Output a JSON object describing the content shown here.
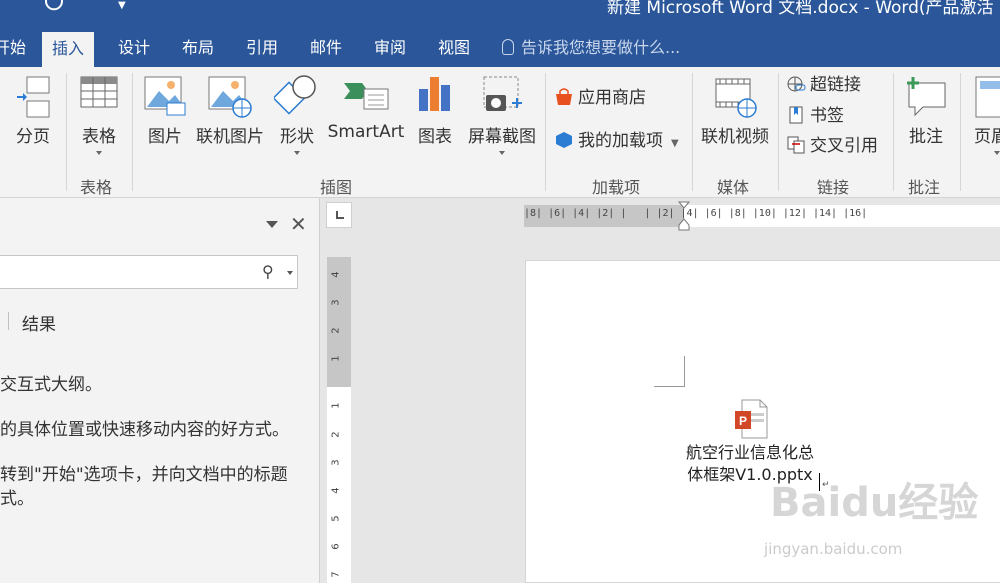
{
  "titlebar": {
    "title": "新建 Microsoft Word 文档.docx - Word(产品激活"
  },
  "tabs": [
    {
      "label": "开始"
    },
    {
      "label": "插入"
    },
    {
      "label": "设计"
    },
    {
      "label": "布局"
    },
    {
      "label": "引用"
    },
    {
      "label": "邮件"
    },
    {
      "label": "审阅"
    },
    {
      "label": "视图"
    }
  ],
  "tellme": {
    "label": "告诉我您想要做什么..."
  },
  "ribbon": {
    "page_break": "分页",
    "table": "表格",
    "picture": "图片",
    "online_picture": "联机图片",
    "shapes": "形状",
    "smartart": "SmartArt",
    "chart": "图表",
    "screenshot": "屏幕截图",
    "store": "应用商店",
    "my_addins": "我的加载项",
    "online_video": "联机视频",
    "hyperlink": "超链接",
    "bookmark": "书签",
    "cross_ref": "交叉引用",
    "comment": "批注",
    "header": "页眉",
    "groups": {
      "tables": "表格",
      "illustrations": "插图",
      "addins": "加载项",
      "media": "媒体",
      "links": "链接",
      "comments": "批注"
    }
  },
  "nav": {
    "results_tab": "结果",
    "lines": [
      "交互式大纲。",
      "的具体位置或快速移动内容的好方式。",
      "转到\"开始\"选项卡，并向文档中的标题",
      "式。"
    ]
  },
  "ruler": {
    "h_numbers": "|8| |6| |4| |2| |   | |2| |4| |6| |8| |10| |12| |14| |16|",
    "v_numbers": [
      "4",
      "3",
      "2",
      "1",
      "1",
      "2",
      "3",
      "4",
      "5",
      "6",
      "7"
    ]
  },
  "document": {
    "file_name_line1": "航空行业信息化总",
    "file_name_line2": "体框架V1.0.pptx"
  },
  "watermark": {
    "brand": "Baidu经验",
    "url": "jingyan.baidu.com"
  },
  "colors": {
    "word_blue": "#2b579a",
    "ribbon_bg": "#f3f3f3",
    "ppt_red": "#d24726"
  }
}
